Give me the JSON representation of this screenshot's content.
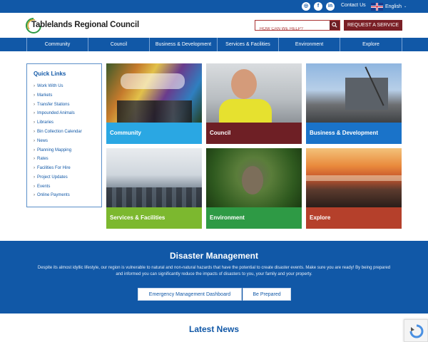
{
  "topbar": {
    "social": [
      "instagram-icon",
      "facebook-icon",
      "linkedin-icon"
    ],
    "contact_label": "Contact Us",
    "language": "English"
  },
  "header": {
    "logo_text": "Tablelands Regional Council",
    "search_placeholder": "HOW CAN WE HELP?",
    "request_label": "REQUEST A SERVICE"
  },
  "nav": {
    "items": [
      "Community",
      "Council",
      "Business & Development",
      "Services & Facilities",
      "Environment",
      "Explore"
    ]
  },
  "quick_links": {
    "title": "Quick Links",
    "items": [
      "Work With Us",
      "Markets",
      "Transfer Stations",
      "Impounded Animals",
      "Libraries",
      "Bin Collection Calendar",
      "News",
      "Planning Mapping",
      "Rates",
      "Facilities For Hire",
      "Project Updates",
      "Events",
      "Online Payments"
    ]
  },
  "tiles": [
    {
      "label": "Community",
      "color": "#2aa7e3"
    },
    {
      "label": "Council",
      "color": "#6e1f25"
    },
    {
      "label": "Business & Development",
      "color": "#1a73c9"
    },
    {
      "label": "Services & Facilities",
      "color": "#7cb82f"
    },
    {
      "label": "Environment",
      "color": "#2e9a45"
    },
    {
      "label": "Explore",
      "color": "#b5402b"
    }
  ],
  "disaster": {
    "title": "Disaster Management",
    "text": "Despite its almost idyllic lifestyle, our region is vulnerable to natural and non-natural hazards that have the potential to create disaster events. Make sure you are ready! By being prepared and informed you can significantly reduce the impacts of disasters to you, your family and your property.",
    "button1": "Emergency Management Dashboard",
    "button2": "Be Prepared"
  },
  "latest_news": "Latest News",
  "colors": {
    "brand_blue": "#1158a7",
    "maroon": "#7a1f26"
  }
}
